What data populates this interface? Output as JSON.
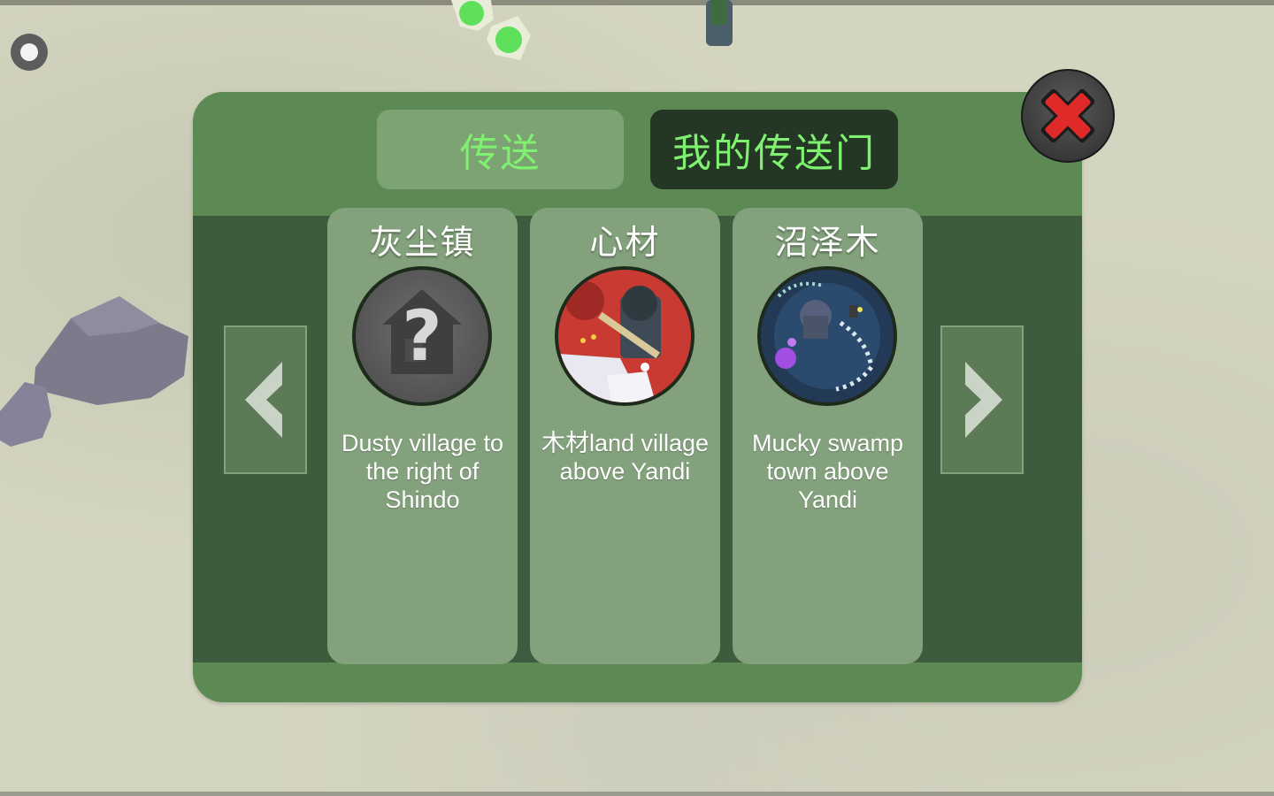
{
  "hud": {
    "record_icon": "record-dot-icon"
  },
  "portal_dialog": {
    "tabs": [
      {
        "label": "传送",
        "active": false
      },
      {
        "label": "我的传送门",
        "active": true
      }
    ],
    "close_icon": "red-x-close-icon",
    "nav": {
      "prev_icon": "chevron-left-icon",
      "next_icon": "chevron-right-icon"
    },
    "portals": [
      {
        "title": "灰尘镇",
        "description": "Dusty village to the right of Shindo",
        "icon": "unknown-house-question-icon"
      },
      {
        "title": "心材",
        "description": "木材land village above Yandi",
        "icon": "village-preview-thumbnail"
      },
      {
        "title": "沼泽木",
        "description": "Mucky swamp town above Yandi",
        "icon": "swamp-preview-thumbnail"
      }
    ]
  },
  "colors": {
    "panel": "#5c8954",
    "panel_inner": "#3f5b3d",
    "card": "#83a17c",
    "tab_text": "#7ff06f",
    "close_red": "#e02a2a"
  }
}
